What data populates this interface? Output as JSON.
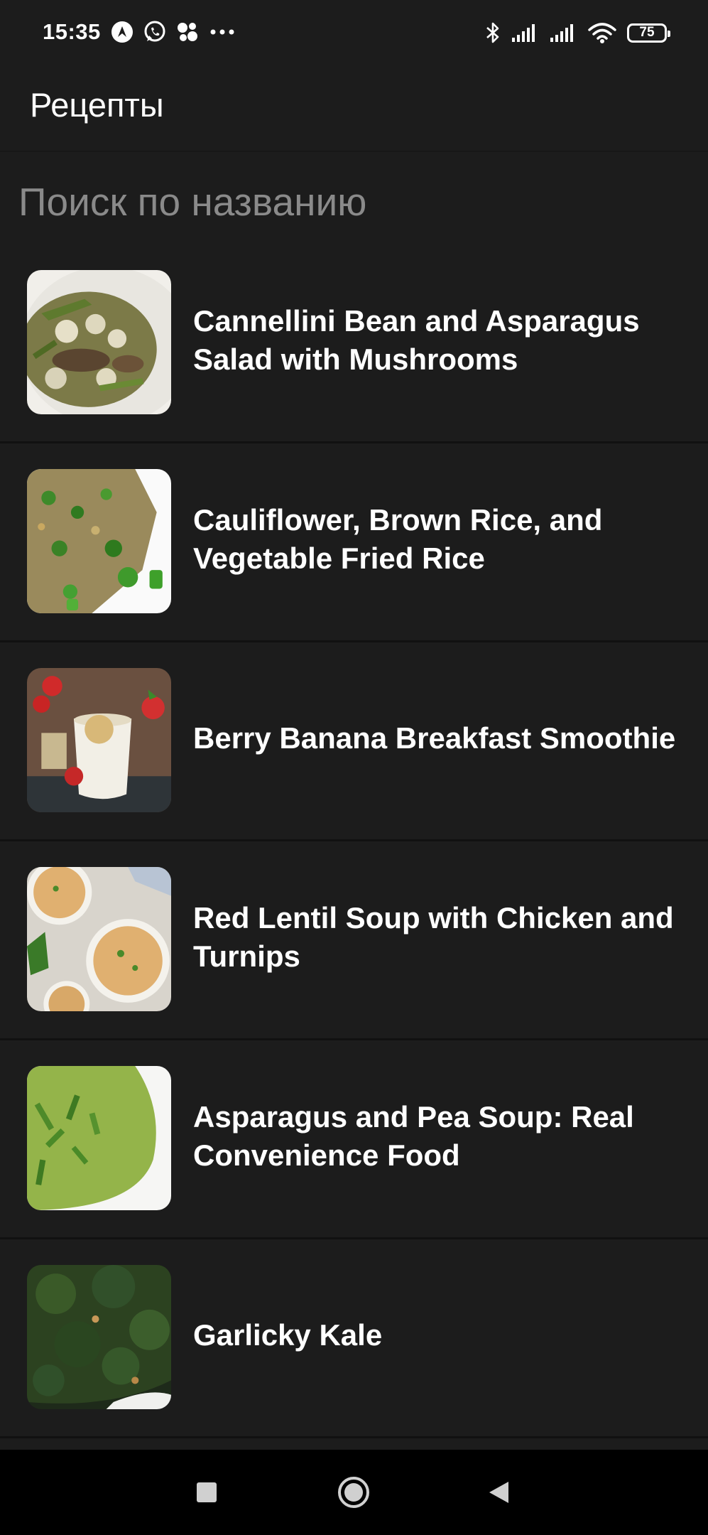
{
  "status_bar": {
    "time": "15:35",
    "battery_level": "75",
    "left_icons": [
      "navigation-app-icon",
      "whatsapp-icon",
      "app-cluster-icon",
      "more-notifications-icon"
    ],
    "right_icons": [
      "bluetooth-icon",
      "signal-icon",
      "signal-icon",
      "wifi-icon",
      "battery-icon"
    ]
  },
  "app_bar": {
    "title": "Рецепты"
  },
  "search": {
    "placeholder": "Поиск по названию",
    "value": ""
  },
  "recipes": [
    {
      "title": "Cannellini Bean and Asparagus Salad with Mushrooms",
      "image": "beans-asparagus-mushroom-dish"
    },
    {
      "title": "Cauliflower, Brown Rice, and Vegetable Fried Rice",
      "image": "fried-rice-broccoli-dish"
    },
    {
      "title": "Berry Banana Breakfast Smoothie",
      "image": "smoothie-glass-strawberries"
    },
    {
      "title": "Red Lentil Soup with Chicken and Turnips",
      "image": "lentil-soup-bowls"
    },
    {
      "title": "Asparagus and Pea Soup: Real Convenience Food",
      "image": "green-pea-soup"
    },
    {
      "title": "Garlicky Kale",
      "image": "sauteed-kale"
    }
  ],
  "nav_bar": {
    "icons": [
      "recents-square-icon",
      "home-circle-icon",
      "back-triangle-icon"
    ]
  },
  "colors": {
    "background": "#1c1c1c",
    "divider": "#111111",
    "text": "#ffffff",
    "placeholder": "#8a8a8a",
    "nav_bar": "#000000"
  }
}
